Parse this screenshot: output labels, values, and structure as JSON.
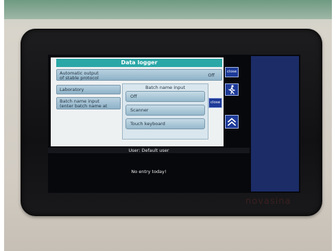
{
  "dialog": {
    "title": "Data logger",
    "rows": [
      {
        "label_line1": "Automatic output",
        "label_line2": "of stable protocol",
        "value": "Off"
      },
      {
        "label": "Laboratory"
      },
      {
        "label_line1": "Batch name input",
        "label_line2": "(enter batch name at"
      }
    ],
    "close_label": "close"
  },
  "batch_panel": {
    "title": "Batch name input",
    "options": [
      "Off",
      "Scanner",
      "Touch keyboard"
    ],
    "close_label": "close"
  },
  "status": {
    "user": "User: Default user",
    "entry_message": "No entry today!"
  },
  "side_icons": [
    "walking-person-icon",
    "double-chevron-up-icon"
  ],
  "brand": "novasina",
  "colors": {
    "title_bar": "#2aa7a7",
    "close_button": "#1d3a98",
    "side_panel": "#1b2c67"
  }
}
